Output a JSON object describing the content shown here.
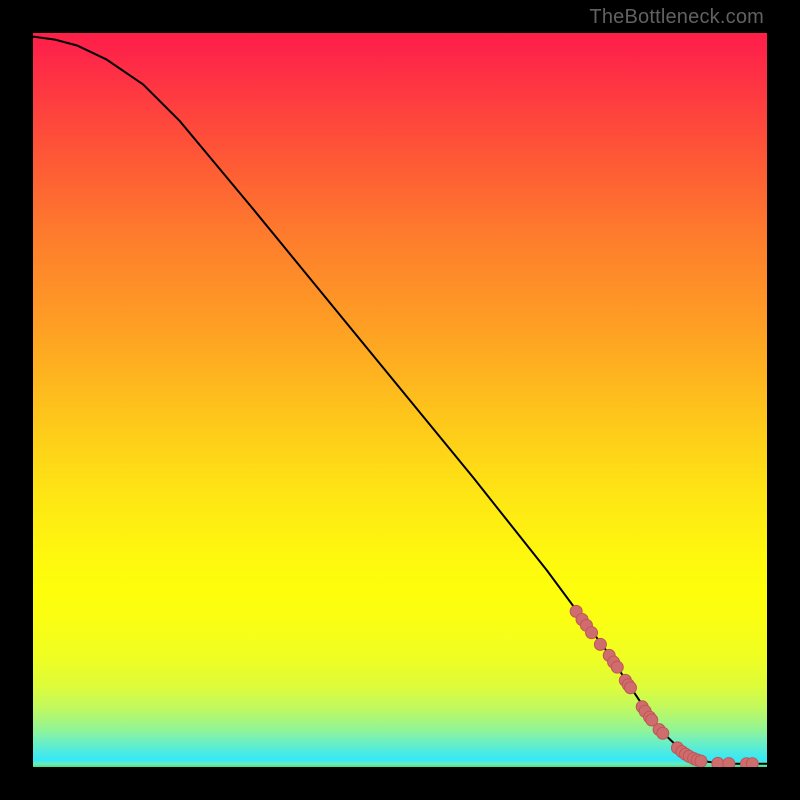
{
  "watermark": "TheBottleneck.com",
  "colors": {
    "frame": "#000000",
    "curve": "#000000",
    "marker_fill": "#cf6d6e",
    "marker_stroke": "#be5557"
  },
  "chart_data": {
    "type": "line",
    "title": "",
    "xlabel": "",
    "ylabel": "",
    "xlim": [
      0,
      100
    ],
    "ylim": [
      0,
      100
    ],
    "grid": false,
    "legend": null,
    "curve": [
      {
        "x": 0,
        "y": 99.5
      },
      {
        "x": 3,
        "y": 99.1
      },
      {
        "x": 6,
        "y": 98.3
      },
      {
        "x": 10,
        "y": 96.4
      },
      {
        "x": 15,
        "y": 93.0
      },
      {
        "x": 20,
        "y": 88.0
      },
      {
        "x": 30,
        "y": 76.0
      },
      {
        "x": 40,
        "y": 63.8
      },
      {
        "x": 50,
        "y": 51.6
      },
      {
        "x": 60,
        "y": 39.4
      },
      {
        "x": 70,
        "y": 26.8
      },
      {
        "x": 78,
        "y": 16.0
      },
      {
        "x": 84,
        "y": 7.0
      },
      {
        "x": 86,
        "y": 4.5
      },
      {
        "x": 88,
        "y": 2.6
      },
      {
        "x": 90,
        "y": 1.3
      },
      {
        "x": 92,
        "y": 0.7
      },
      {
        "x": 95,
        "y": 0.45
      },
      {
        "x": 100,
        "y": 0.45
      }
    ],
    "markers": [
      {
        "x": 74.0,
        "y": 21.2
      },
      {
        "x": 74.8,
        "y": 20.1
      },
      {
        "x": 75.4,
        "y": 19.3
      },
      {
        "x": 76.1,
        "y": 18.3
      },
      {
        "x": 77.3,
        "y": 16.7
      },
      {
        "x": 78.5,
        "y": 15.2
      },
      {
        "x": 79.1,
        "y": 14.3
      },
      {
        "x": 79.6,
        "y": 13.6
      },
      {
        "x": 80.7,
        "y": 11.8
      },
      {
        "x": 81.1,
        "y": 11.2
      },
      {
        "x": 81.4,
        "y": 10.8
      },
      {
        "x": 83.0,
        "y": 8.2
      },
      {
        "x": 83.4,
        "y": 7.6
      },
      {
        "x": 84.0,
        "y": 6.8
      },
      {
        "x": 84.3,
        "y": 6.4
      },
      {
        "x": 85.3,
        "y": 5.1
      },
      {
        "x": 85.8,
        "y": 4.6
      },
      {
        "x": 87.8,
        "y": 2.6
      },
      {
        "x": 88.4,
        "y": 2.1
      },
      {
        "x": 88.9,
        "y": 1.75
      },
      {
        "x": 89.4,
        "y": 1.45
      },
      {
        "x": 90.0,
        "y": 1.15
      },
      {
        "x": 90.5,
        "y": 0.95
      },
      {
        "x": 91.0,
        "y": 0.8
      },
      {
        "x": 93.3,
        "y": 0.5
      },
      {
        "x": 94.8,
        "y": 0.46
      },
      {
        "x": 97.2,
        "y": 0.45
      },
      {
        "x": 98.0,
        "y": 0.45
      }
    ],
    "marker_radius_px": 6
  }
}
